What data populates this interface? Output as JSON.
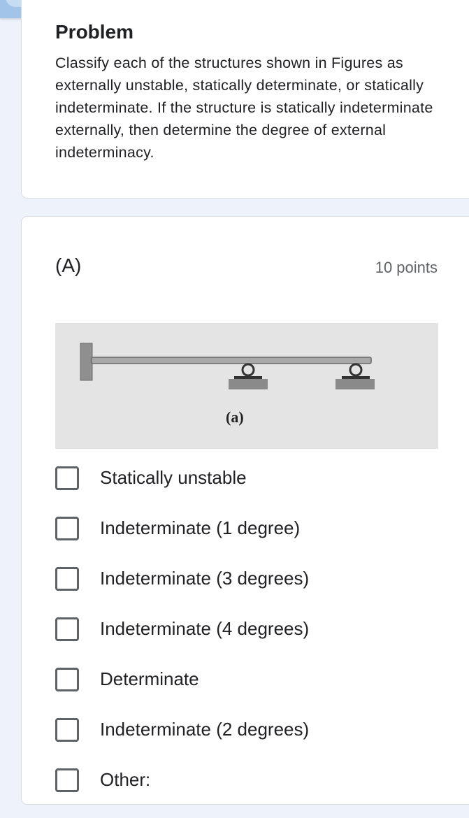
{
  "description_card": {
    "title": "Problem",
    "text": "Classify each of the structures shown in Figures as externally unstable, statically determinate, or statically indeterminate. If the structure is statically indeterminate externally, then determine the degree of external indeterminacy."
  },
  "question": {
    "title": "(A)",
    "points": "10 points",
    "figure": {
      "caption": "(a)"
    },
    "options": [
      {
        "label": "Statically unstable",
        "checked": false
      },
      {
        "label": "Indeterminate (1 degree)",
        "checked": false
      },
      {
        "label": "Indeterminate (3 degrees)",
        "checked": false
      },
      {
        "label": "Indeterminate (4 degrees)",
        "checked": false
      },
      {
        "label": "Determinate",
        "checked": false
      },
      {
        "label": "Indeterminate (2 degrees)",
        "checked": false
      },
      {
        "label": "Other:",
        "checked": false
      }
    ]
  },
  "colors": {
    "header_bar": "#a2c4e9",
    "page_background": "#eef2fa",
    "card_background": "#ffffff",
    "checkbox_border": "#5f6368"
  }
}
